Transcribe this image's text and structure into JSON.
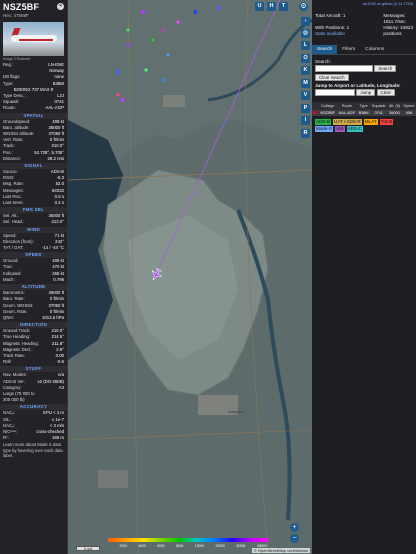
{
  "info": {
    "callsign": "NSZ5BF",
    "hex_label": "Hex: 47888F",
    "photo_credit": "Image © Bostroth",
    "basic": [
      {
        "k": "Reg.:",
        "v": "LN-ENE",
        "link": true
      },
      {
        "k": "",
        "v": "Norway"
      },
      {
        "k": "DB flags:",
        "v": "none"
      },
      {
        "k": "Type:",
        "v": "B38M"
      },
      {
        "k": "",
        "v": "BOEING 737 MAX 8",
        "center": true
      },
      {
        "k": "Type Desc.:",
        "v": "L2J"
      },
      {
        "k": "Squawk:",
        "v": "0741"
      },
      {
        "k": "Route:",
        "v": "AAL-AGP",
        "link": true
      }
    ],
    "spatial_title": "SPATIAL",
    "spatial": [
      {
        "k": "Groundspeed:",
        "v": "408 kt"
      },
      {
        "k": "Baro. altitude:",
        "v": "36000 ft"
      },
      {
        "k": "WGS84 altitude:",
        "v": "37050 ft"
      },
      {
        "k": "Vert. Rate:",
        "v": "0 ft/min"
      },
      {
        "k": "Track:",
        "v": "210.0°"
      },
      {
        "k": "Pos.:",
        "v": "52.728°, 5.708°"
      },
      {
        "k": "Distance:",
        "v": "28.2 nmi"
      }
    ],
    "signal_title": "SIGNAL",
    "signal": [
      {
        "k": "Source:",
        "v": "ADS-B"
      },
      {
        "k": "RSSI:",
        "v": "-5.3"
      },
      {
        "k": "Msg. Rate:",
        "v": "52.0"
      },
      {
        "k": "Messages:",
        "v": "84032"
      },
      {
        "k": "Last Pos.:",
        "v": "0.5 s"
      },
      {
        "k": "Last Seen:",
        "v": "0.2 s"
      }
    ],
    "fms_title": "FMS SEL",
    "fms": [
      {
        "k": "Sel. Alt.:",
        "v": "36000 ft"
      },
      {
        "k": "Sel. Head.:",
        "v": "213.0°"
      }
    ],
    "wind_title": "WIND",
    "wind": [
      {
        "k": "Speed:",
        "v": "71 kt"
      },
      {
        "k": "Direction (from):",
        "v": "242°"
      },
      {
        "k": "TAT / OAT:",
        "v": "-14 / -44 °C"
      }
    ],
    "speed_title": "SPEED",
    "speed": [
      {
        "k": "Ground:",
        "v": "408 kt"
      },
      {
        "k": "True:",
        "v": "470 kt"
      },
      {
        "k": "Indicated:",
        "v": "265 kt"
      },
      {
        "k": "Mach:",
        "v": "0.796"
      }
    ],
    "altitude_title": "ALTITUDE",
    "altitude": [
      {
        "k": "Barometric:",
        "v": "36000 ft"
      },
      {
        "k": "Baro. Rate:",
        "v": "0 ft/min"
      },
      {
        "k": "Geom. WGS84:",
        "v": "37050 ft"
      },
      {
        "k": "Geom. Rate:",
        "v": "0 ft/min"
      },
      {
        "k": "QNH:",
        "v": "1013.6 hPa"
      }
    ],
    "direction_title": "DIRECTION",
    "direction": [
      {
        "k": "Ground Track:",
        "v": "210.0°"
      },
      {
        "k": "True Heading:",
        "v": "214.6°"
      },
      {
        "k": "Magnetic Heading:",
        "v": "211.8°"
      },
      {
        "k": "Magnetic Decl.:",
        "v": "2.9°"
      },
      {
        "k": "Track Rate:",
        "v": "0.00"
      },
      {
        "k": "Roll:",
        "v": "-0.5"
      }
    ],
    "stuff_title": "STUFF",
    "stuff": [
      {
        "k": "Nav. Modes:",
        "v": "n/a"
      },
      {
        "k": "ADS-B Ver.:",
        "v": "v2 (DO-260B)"
      },
      {
        "k": "Category:",
        "v": "A3"
      },
      {
        "k": "Large (75 000 to",
        "v": ""
      },
      {
        "k": "300 000 lb)",
        "v": ""
      }
    ],
    "accuracy_title": "ACCURACY",
    "accuracy": [
      {
        "k": "NACₚ:",
        "v": "EPU < 3 m"
      },
      {
        "k": "SIL:",
        "v": "≤ 1e-7"
      },
      {
        "k": "NACᵥ:",
        "v": "< 3 m/s"
      },
      {
        "k": "NICᵇᵃʳᵒ:",
        "v": "cross-checked"
      },
      {
        "k": "Rᶜ:",
        "v": "186 m"
      }
    ],
    "footer": "Learn more about Mode S data type by hovering over each data label."
  },
  "map": {
    "buttons_right": [
      "U",
      "H",
      "T"
    ],
    "buttons_col": [
      "L",
      "O",
      "K",
      "M",
      "V",
      "P",
      "I",
      "R"
    ],
    "scale": "5 nmi",
    "alt_labels": [
      "",
      "2000",
      "4000",
      "6000",
      "8000",
      "10000",
      "20000",
      "30000",
      "40000+"
    ],
    "town_label": "Kampen",
    "osm_credit": "© OpenStreetMap contributors"
  },
  "side": {
    "top_link": "tar1090 on github (2.14.1754)",
    "total_aircraft": "Total Aircraft: 1",
    "with_positions": "With Positions: 1",
    "stats_available": "Stats available",
    "messages_label": "Messages:",
    "messages_val": "1911.7/sec",
    "history_label": "History: 24823",
    "history_unit": "positions",
    "tabs": [
      "Search",
      "Filters",
      "Columns"
    ],
    "search_label": "Search:",
    "search_btn": "Search",
    "clear_search_btn": "Clear Search",
    "jump_label": "Jump to Airport or Latitude, Longitude:",
    "jump_btn": "Jump",
    "clear_btn": "Clear",
    "columns": [
      "",
      "Callsign",
      "Route",
      "Type",
      "Squawk",
      "Alt. (ft)",
      "Speed"
    ],
    "rows": [
      [
        "",
        "NSZ5BF",
        "AAL-AGP",
        "B38M",
        "0741",
        "36000",
        "408"
      ]
    ],
    "sources": [
      {
        "label": "ADS-B",
        "color": "#2ab24a"
      },
      {
        "label": "UAT / ADS-R",
        "color": "#cfa94a"
      },
      {
        "label": "MLAT",
        "color": "#ffa500"
      },
      {
        "label": "TIS-B",
        "color": "#ff4040"
      },
      {
        "label": "Mode-S",
        "color": "#6fa8ff"
      },
      {
        "label": "AIS",
        "color": "#9b59b6"
      },
      {
        "label": "ADS-C",
        "color": "#38c0c0"
      }
    ]
  }
}
